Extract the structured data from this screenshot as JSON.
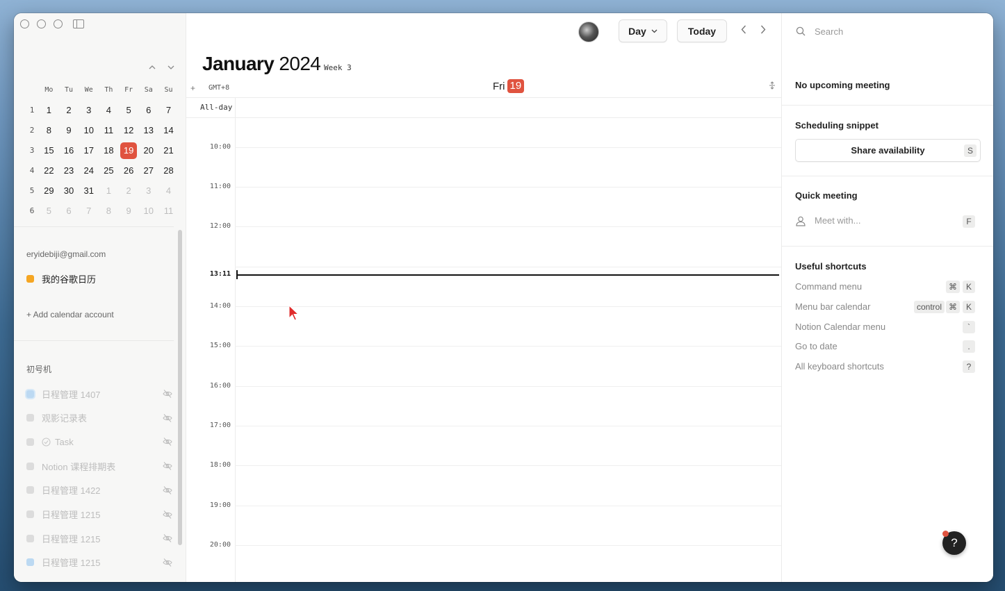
{
  "sidebar": {
    "mini_calendar": {
      "weekday_headers": [
        "Mo",
        "Tu",
        "We",
        "Th",
        "Fr",
        "Sa",
        "Su"
      ],
      "weeks": [
        {
          "num": "1",
          "days": [
            {
              "d": "1"
            },
            {
              "d": "2"
            },
            {
              "d": "3"
            },
            {
              "d": "4"
            },
            {
              "d": "5"
            },
            {
              "d": "6"
            },
            {
              "d": "7"
            }
          ]
        },
        {
          "num": "2",
          "days": [
            {
              "d": "8"
            },
            {
              "d": "9"
            },
            {
              "d": "10"
            },
            {
              "d": "11"
            },
            {
              "d": "12"
            },
            {
              "d": "13"
            },
            {
              "d": "14"
            }
          ]
        },
        {
          "num": "3",
          "days": [
            {
              "d": "15"
            },
            {
              "d": "16"
            },
            {
              "d": "17"
            },
            {
              "d": "18"
            },
            {
              "d": "19",
              "today": true
            },
            {
              "d": "20"
            },
            {
              "d": "21"
            }
          ]
        },
        {
          "num": "4",
          "days": [
            {
              "d": "22"
            },
            {
              "d": "23"
            },
            {
              "d": "24"
            },
            {
              "d": "25"
            },
            {
              "d": "26"
            },
            {
              "d": "27"
            },
            {
              "d": "28"
            }
          ]
        },
        {
          "num": "5",
          "days": [
            {
              "d": "29"
            },
            {
              "d": "30"
            },
            {
              "d": "31"
            },
            {
              "d": "1",
              "muted": true
            },
            {
              "d": "2",
              "muted": true
            },
            {
              "d": "3",
              "muted": true
            },
            {
              "d": "4",
              "muted": true
            }
          ]
        },
        {
          "num": "6",
          "days": [
            {
              "d": "5",
              "muted": true
            },
            {
              "d": "6",
              "muted": true
            },
            {
              "d": "7",
              "muted": true
            },
            {
              "d": "8",
              "muted": true
            },
            {
              "d": "9",
              "muted": true
            },
            {
              "d": "10",
              "muted": true
            },
            {
              "d": "11",
              "muted": true
            }
          ]
        }
      ]
    },
    "account_email": "eryidebiji@gmail.com",
    "primary_calendar": {
      "label": "我的谷歌日历",
      "color": "#f5a623"
    },
    "add_account_label": "+ Add calendar account",
    "group_title": "初号机",
    "hidden_calendars": [
      {
        "label": "日程管理 1407",
        "color": "#bcd9f2"
      },
      {
        "label": "观影记录表",
        "color": "#dcdcdc"
      },
      {
        "label": "Task",
        "color": "#dcdcdc"
      },
      {
        "label": "Notion 课程排期表",
        "color": "#dcdcdc"
      },
      {
        "label": "日程管理 1422",
        "color": "#dcdcdc"
      },
      {
        "label": "日程管理 1215",
        "color": "#dcdcdc"
      },
      {
        "label": "日程管理 1215",
        "color": "#dcdcdc"
      },
      {
        "label": "日程管理 1215",
        "color": "#bcd9f2"
      }
    ]
  },
  "toolbar": {
    "view_label": "Day",
    "today_label": "Today"
  },
  "header": {
    "month": "January",
    "year": "2024",
    "week_label": "Week 3",
    "timezone": "GMT+8",
    "day_name": "Fri",
    "day_number": "19"
  },
  "grid": {
    "allday_label": "All-day",
    "hours": [
      "10:00",
      "11:00",
      "12:00",
      "14:00",
      "15:00",
      "16:00",
      "17:00",
      "18:00",
      "19:00",
      "20:00"
    ],
    "now_label": "13:11"
  },
  "right_panel": {
    "search_placeholder": "Search",
    "no_meeting": "No upcoming meeting",
    "snippet_title": "Scheduling snippet",
    "share_label": "Share availability",
    "share_key": "S",
    "quick_title": "Quick meeting",
    "meet_placeholder": "Meet with...",
    "meet_key": "F",
    "shortcuts_title": "Useful shortcuts",
    "shortcuts": [
      {
        "label": "Command menu",
        "keys": [
          "⌘",
          "K"
        ]
      },
      {
        "label": "Menu bar calendar",
        "keys": [
          "control",
          "⌘",
          "K"
        ]
      },
      {
        "label": "Notion Calendar menu",
        "keys": [
          "`"
        ]
      },
      {
        "label": "Go to date",
        "keys": [
          "."
        ]
      },
      {
        "label": "All keyboard shortcuts",
        "keys": [
          "?"
        ]
      }
    ],
    "help_label": "?"
  },
  "colors": {
    "accent": "#e0533f"
  }
}
